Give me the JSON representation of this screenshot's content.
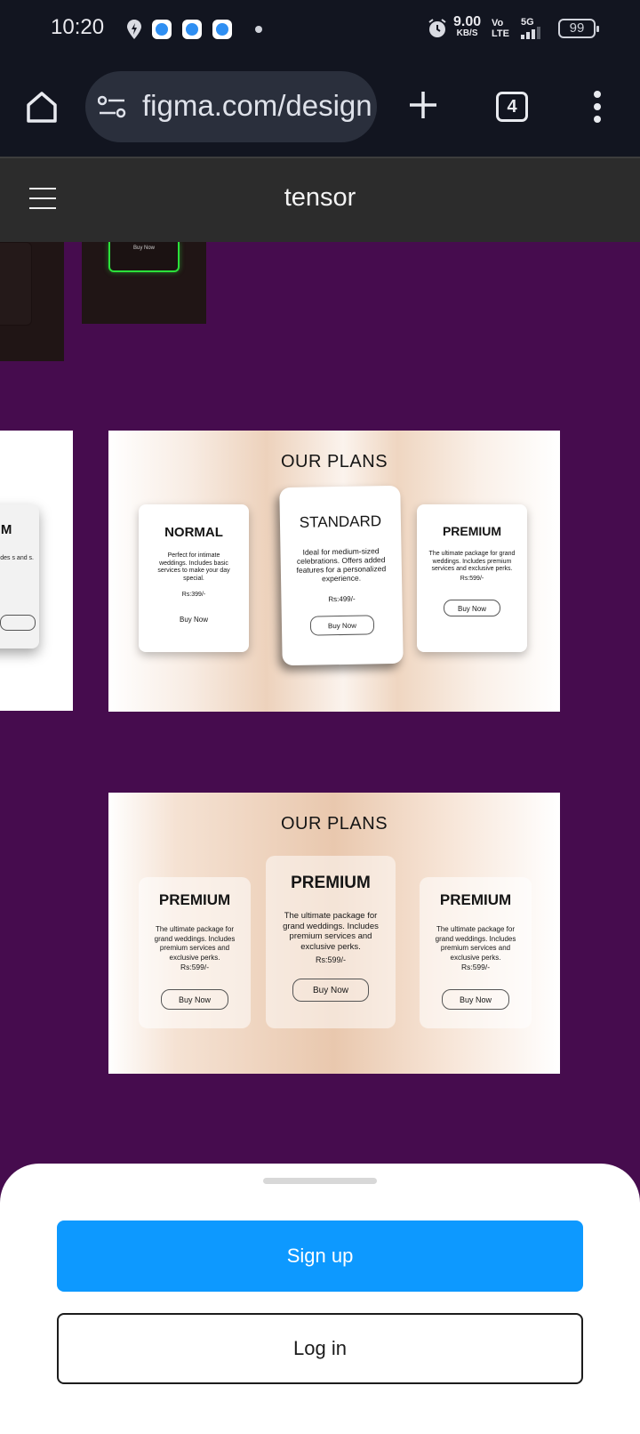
{
  "status_bar": {
    "time": "10:20",
    "net_speed": "9.00",
    "net_unit": "KB/S",
    "volte": "Vo LTE",
    "network": "5G",
    "battery": "99",
    "icons": [
      "location-icon",
      "app-notification-icon",
      "app-notification-icon",
      "app-notification-icon",
      "more-dot-icon",
      "alarm-icon",
      "signal-icon",
      "battery-icon"
    ]
  },
  "browser": {
    "url": "figma.com/design",
    "tab_count": "4",
    "icons": [
      "home-icon",
      "site-settings-icon",
      "new-tab-icon",
      "tab-switcher-icon",
      "overflow-menu-icon"
    ]
  },
  "figma": {
    "file_title": "tensor",
    "menu_icon": "hamburger-menu-icon"
  },
  "canvas": {
    "dark_card_button": "Buy Now",
    "cut_frame": {
      "title": "UM",
      "desc": "age for ludes s and s."
    },
    "plans_frame_1": {
      "heading": "OUR PLANS",
      "cards": [
        {
          "title": "NORMAL",
          "desc": "Perfect for intimate weddings. Includes basic services to make your day special.",
          "price": "Rs:399/-",
          "button": "Buy Now"
        },
        {
          "title": "STANDARD",
          "desc": "Ideal for medium-sized celebrations. Offers added features for a personalized experience.",
          "price": "Rs:499/-",
          "button": "Buy Now"
        },
        {
          "title": "PREMIUM",
          "desc": "The ultimate package for grand weddings. Includes premium services and exclusive perks.",
          "price": "Rs:599/-",
          "button": "Buy Now"
        }
      ]
    },
    "plans_frame_2": {
      "heading": "OUR PLANS",
      "cards": [
        {
          "title": "PREMIUM",
          "desc": "The ultimate package for grand weddings. Includes premium services and exclusive perks.",
          "price": "Rs:599/-",
          "button": "Buy Now"
        },
        {
          "title": "PREMIUM",
          "desc": "The ultimate package for grand weddings. Includes premium services and exclusive perks.",
          "price": "Rs:599/-",
          "button": "Buy Now"
        },
        {
          "title": "PREMIUM",
          "desc": "The ultimate package for grand weddings. Includes premium services and exclusive perks.",
          "price": "Rs:599/-",
          "button": "Buy Now"
        }
      ]
    }
  },
  "sheet": {
    "signup": "Sign up",
    "login": "Log in"
  },
  "colors": {
    "canvas_bg": "#460c4e",
    "accent": "#0d99ff",
    "browser_bg": "#121520",
    "figma_header": "#2c2c2c"
  }
}
